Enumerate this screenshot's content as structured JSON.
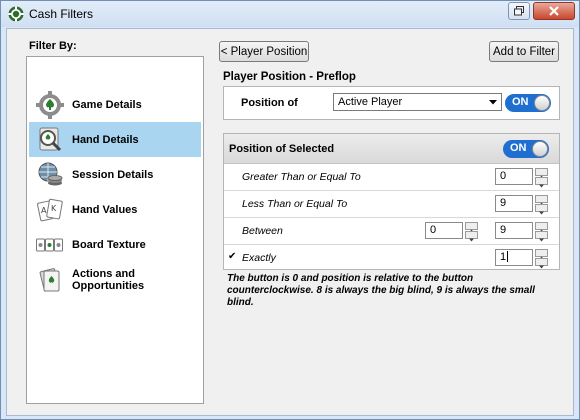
{
  "window": {
    "title": "Cash Filters"
  },
  "sidebar": {
    "heading": "Filter By:",
    "items": [
      {
        "label": "Game Details",
        "icon": "gear-spade-icon",
        "active": false
      },
      {
        "label": "Hand Details",
        "icon": "magnifier-card-icon",
        "active": true
      },
      {
        "label": "Session Details",
        "icon": "globe-chips-icon",
        "active": false
      },
      {
        "label": "Hand Values",
        "icon": "playing-cards-icon",
        "active": false
      },
      {
        "label": "Board Texture",
        "icon": "board-cards-icon",
        "active": false
      },
      {
        "label": "Actions and Opportunities",
        "icon": "action-cards-icon",
        "active": false
      }
    ]
  },
  "toolbar": {
    "back_label": "< Player Position",
    "add_label": "Add to Filter"
  },
  "panel": {
    "title": "Player Position - Preflop",
    "position_of_label": "Position of",
    "position_of_value": "Active Player",
    "position_toggle": "ON",
    "selected_header": "Position of Selected",
    "selected_toggle": "ON",
    "rows": [
      {
        "label": "Greater Than or Equal To",
        "value": "0"
      },
      {
        "label": "Less Than or Equal To",
        "value": "9"
      },
      {
        "label": "Between",
        "value_from": "0",
        "value_to": "9"
      },
      {
        "label": "Exactly",
        "value": "1",
        "checked": "✔"
      }
    ],
    "note": "The button is 0 and position is relative to the button counterclockwise.  8 is always the big blind, 9 is always the small blind."
  },
  "colors": {
    "accent": "#1f6fd1",
    "selected_item": "#a9d5f1"
  }
}
